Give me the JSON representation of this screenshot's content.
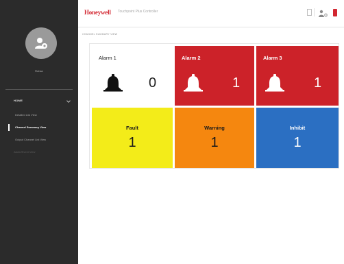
{
  "header": {
    "logo": "Honeywell",
    "title": "Touchpoint Plus Controller"
  },
  "sidebar": {
    "user_name": "Rohan",
    "nav_header": "HOME",
    "items": [
      {
        "label": "Detailed List View"
      },
      {
        "label": "Channel Summary View"
      },
      {
        "label": "Output Channel List View"
      },
      {
        "label": "Alarm/Event View"
      }
    ]
  },
  "breadcrumb": "CHANNEL SUMMARY VIEW",
  "tiles": {
    "alarm1": {
      "label": "Alarm 1",
      "count": "0",
      "color": "#ffffff"
    },
    "alarm2": {
      "label": "Alarm 2",
      "count": "1",
      "color": "#cc2229"
    },
    "alarm3": {
      "label": "Alarm 3",
      "count": "1",
      "color": "#cc2229"
    },
    "fault": {
      "label": "Fault",
      "count": "1",
      "color": "#f3ec19"
    },
    "warning": {
      "label": "Warning",
      "count": "1",
      "color": "#f5870f"
    },
    "inhibit": {
      "label": "Inhibit",
      "count": "1",
      "color": "#2b6fc2"
    }
  },
  "icons": {
    "avatar": "user-avatar-icon",
    "doc": "document-icon",
    "user_menu": "user-icon",
    "exit": "exit-icon",
    "bell": "bell-icon"
  },
  "colors": {
    "brand": "#d22630",
    "sidebar_bg": "#2b2b2b"
  }
}
